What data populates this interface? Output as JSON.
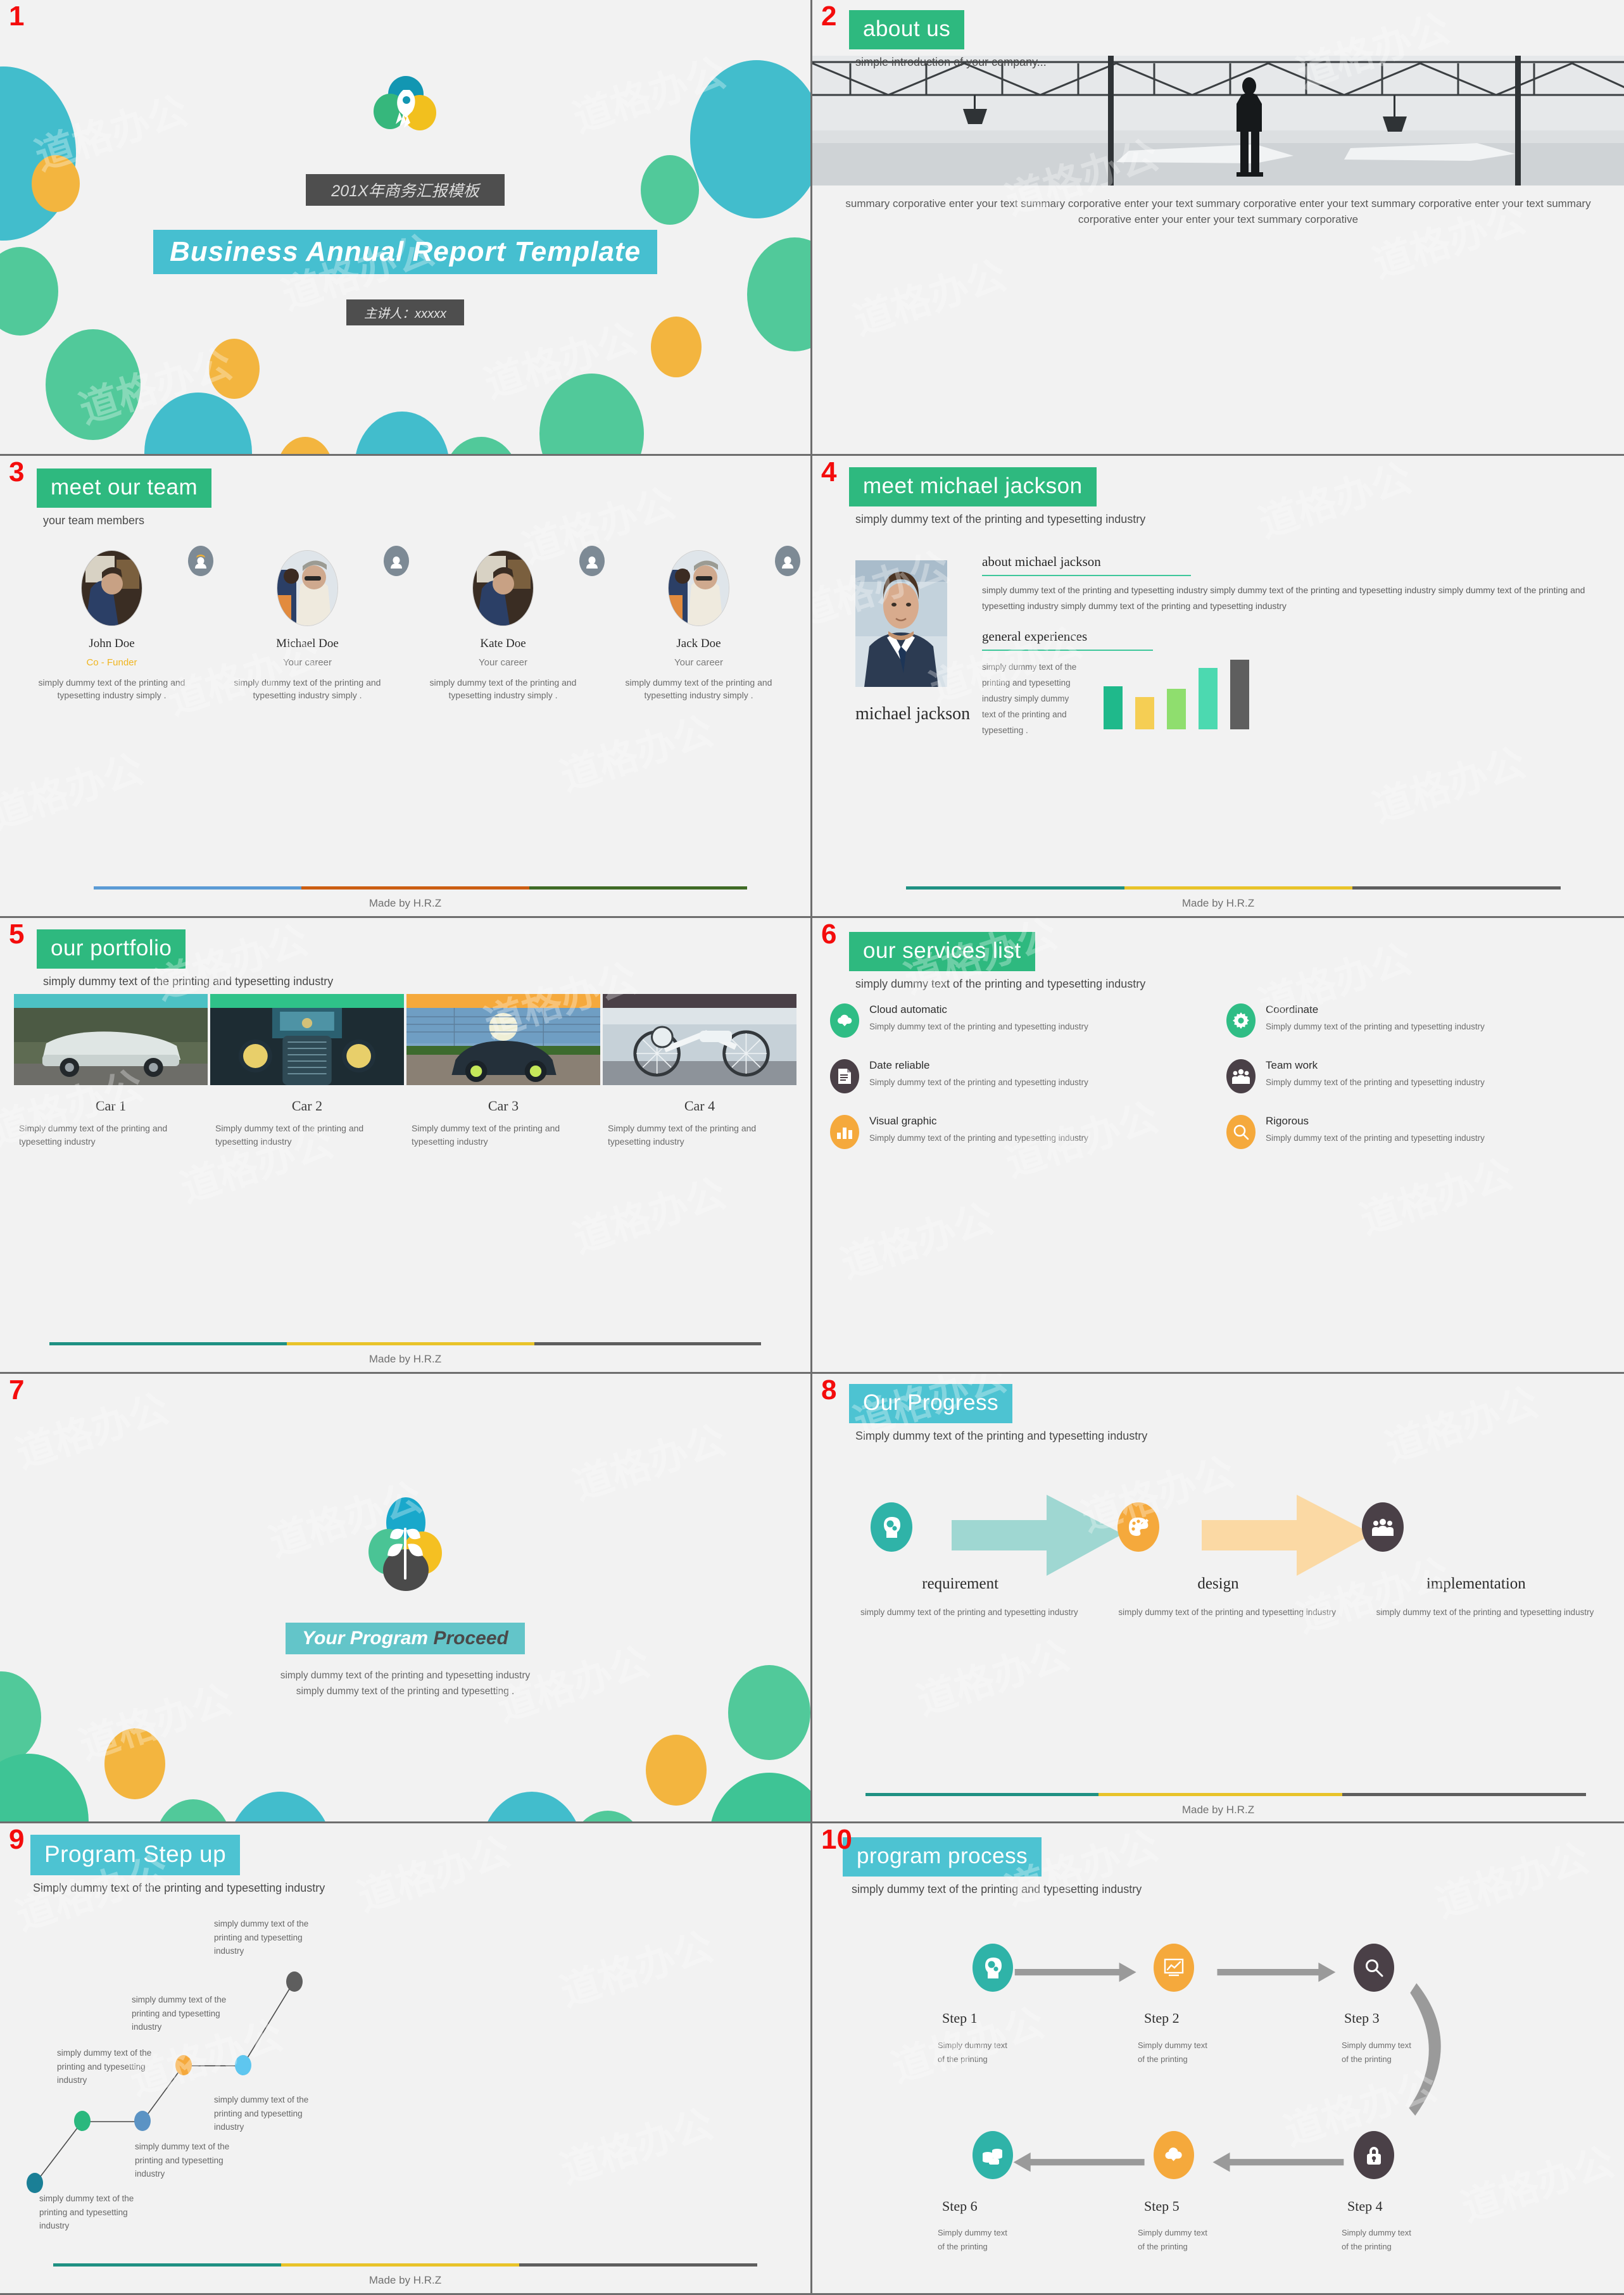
{
  "theme": {
    "green": "#2eb97f",
    "cyan": "#4dc3d2",
    "orange": "#f5a93c",
    "dark": "#4a4047",
    "teal": "#2fb3a8",
    "yellow": "#f0c419",
    "gray": "#5e5e5e",
    "slide_bg": "#f2f2f2",
    "number_color": "#f40c0c"
  },
  "watermark": "道格办公",
  "slides": [
    {
      "number": "1",
      "zh_title": "201X年商务汇报模板",
      "en_title": "Business  Annual  Report Template",
      "speaker": "主讲人：xxxxx",
      "logo_icon": "rocket-icon"
    },
    {
      "number": "2",
      "banner": "about us",
      "subhead": "simple introduction of your company...",
      "image_alt": "businessman-silhouette-airport-window-photo",
      "body": "summary corporative  enter your text summary corporative  enter your text summary corporative  enter your text summary corporative  enter your text summary corporative  enter your enter your text summary corporative"
    },
    {
      "number": "3",
      "banner": "meet our team",
      "subhead": "your team members",
      "footer": "Made by H.R.Z",
      "members": [
        {
          "name": "John   Doe",
          "role": "Co - Funder",
          "desc": "simply dummy text of the printing and typesetting industry simply ."
        },
        {
          "name": "Michael   Doe",
          "role": "Your career",
          "desc": "simply dummy text of the printing and typesetting industry simply ."
        },
        {
          "name": "Kate  Doe",
          "role": "Your career",
          "desc": "simply dummy text of the printing and typesetting industry simply ."
        },
        {
          "name": "Jack  Doe",
          "role": "Your career",
          "desc": "simply dummy text of the printing and typesetting industry simply ."
        }
      ]
    },
    {
      "number": "4",
      "banner": "meet  michael jackson",
      "subhead": "simply dummy text of the printing and typesetting industry",
      "person_name": "michael jackson",
      "about_heading": "about  michael jackson",
      "about_body": "simply dummy text of the printing and typesetting industry simply dummy text of the printing and typesetting industry  simply dummy text of the printing and typesetting industry  simply dummy text of the printing and typesetting industry",
      "exp_heading": "general experiences",
      "exp_body": "simply dummy text of the printing and typesetting industry simply dummy text of the printing and typesetting .",
      "footer": "Made by H.R.Z"
    },
    {
      "number": "5",
      "banner": "our portfolio",
      "subhead": "simply dummy text of the printing and typesetting industry",
      "footer": "Made by H.R.Z",
      "cards": [
        {
          "title": "Car 1",
          "desc": "Simply dummy text of the printing and typesetting industry",
          "cap_color": "#4cc1c4"
        },
        {
          "title": "Car 2",
          "desc": "Simply dummy text of the printing and typesetting industry",
          "cap_color": "#2fc289"
        },
        {
          "title": "Car 3",
          "desc": "Simply dummy text of the printing and typesetting industry",
          "cap_color": "#f5a93c"
        },
        {
          "title": "Car 4",
          "desc": "Simply dummy text of the printing and typesetting industry",
          "cap_color": "#4a4047"
        }
      ]
    },
    {
      "number": "6",
      "banner": "our services list",
      "subhead": "simply dummy text of the printing and typesetting industry",
      "services": [
        {
          "title": "Cloud automatic",
          "desc": "Simply dummy text of the printing and typesetting industry",
          "icon": "cloud-download-icon",
          "color": "#2fbd85"
        },
        {
          "title": "Coordinate",
          "desc": "Simply dummy text of the printing and typesetting  industry",
          "icon": "gear-icon",
          "color": "#2fbd85"
        },
        {
          "title": "Date  reliable",
          "desc": "Simply dummy text of the printing and typesetting  industry",
          "icon": "document-icon",
          "color": "#4a4047"
        },
        {
          "title": "Team work",
          "desc": "Simply dummy text of the printing and typesetting  industry",
          "icon": "people-group-icon",
          "color": "#4a4047"
        },
        {
          "title": "Visual graphic",
          "desc": "Simply dummy text of the printing and typesetting industry",
          "icon": "bar-chart-icon",
          "color": "#f5a93c"
        },
        {
          "title": "Rigorous",
          "desc": "Simply dummy text of the printing and typesetting  industry",
          "icon": "magnifier-icon",
          "color": "#f5a93c"
        }
      ]
    },
    {
      "number": "7",
      "title_light": "Your Program ",
      "title_dark": " Proceed",
      "sub_line1": "simply dummy text of the printing and typesetting industry",
      "sub_line2": "simply dummy text of the printing and typesetting .",
      "logo_icon": "sprout-plant-icon"
    },
    {
      "number": "8",
      "banner": "Our Progress",
      "subhead": "Simply dummy text of the printing and typesetting industry",
      "footer": "Made by H.R.Z",
      "steps": [
        {
          "title": "requirement",
          "desc": "simply dummy text of the printing and typesetting industry",
          "icon": "head-gears-icon",
          "color": "#2fb3a8"
        },
        {
          "title": "design",
          "desc": "simply dummy text of the printing and typesetting industry",
          "icon": "palette-brush-icon",
          "color": "#f5a93c"
        },
        {
          "title": "implementation",
          "desc": "simply dummy text of the printing and typesetting industry",
          "icon": "people-group-icon",
          "color": "#4a4047"
        }
      ]
    },
    {
      "number": "9",
      "banner": "Program Step up",
      "subhead": "Simply dummy text of the printing and typesetting industry",
      "footer": "Made by H.R.Z",
      "labels": [
        "simply dummy text of the printing and typesetting industry",
        "simply dummy text of the printing and typesetting industry",
        "simply dummy text of the printing and typesetting industry",
        "simply dummy text of the printing and typesetting industry",
        "simply dummy text of the printing and typesetting industry",
        "simply dummy text of the printing and typesetting industry"
      ]
    },
    {
      "number": "10",
      "banner": "program  process",
      "subhead": "simply dummy text of the printing and typesetting industry",
      "steps": [
        {
          "title": "Step 1",
          "desc": "Simply dummy text of the printing",
          "icon": "head-gears-icon",
          "color": "#2fb3a8"
        },
        {
          "title": "Step 2",
          "desc": "Simply dummy text of the printing",
          "icon": "line-chart-icon",
          "color": "#f5a93c"
        },
        {
          "title": "Step 3",
          "desc": "Simply dummy text of the printing",
          "icon": "magnifier-icon",
          "color": "#4a4047"
        },
        {
          "title": "Step 4",
          "desc": "Simply dummy text of the printing",
          "icon": "lock-icon",
          "color": "#4a4047"
        },
        {
          "title": "Step 5",
          "desc": "Simply dummy text of the printing",
          "icon": "cloud-download-icon",
          "color": "#f5a93c"
        },
        {
          "title": "Step 6",
          "desc": "Simply dummy text of the printing",
          "icon": "coins-stack-icon",
          "color": "#2fb3a8"
        }
      ]
    }
  ],
  "chart_data": [
    {
      "type": "bar",
      "title": "general experiences",
      "slide": 4,
      "categories": [
        "1",
        "2",
        "3",
        "4",
        "5"
      ],
      "values": [
        62,
        46,
        58,
        88,
        100
      ],
      "colors": [
        "#1fb98b",
        "#f5ce54",
        "#8fde6e",
        "#4cd9b0",
        "#5e5e5e"
      ],
      "xlabel": "",
      "ylabel": "",
      "ylim": [
        0,
        100
      ],
      "grid": false,
      "legend": false
    },
    {
      "type": "line",
      "title": "Program Step up",
      "slide": 9,
      "x": [
        1,
        2,
        3,
        4,
        5,
        6
      ],
      "values": [
        8,
        34,
        34,
        58,
        58,
        92
      ],
      "point_colors": [
        "#1a7f96",
        "#2ab87e",
        "#5b93c4",
        "#f5a93c",
        "#5ec6ef",
        "#5e5e5e"
      ],
      "xlabel": "",
      "ylabel": "",
      "ylim": [
        0,
        100
      ],
      "grid": false,
      "legend": false
    }
  ]
}
